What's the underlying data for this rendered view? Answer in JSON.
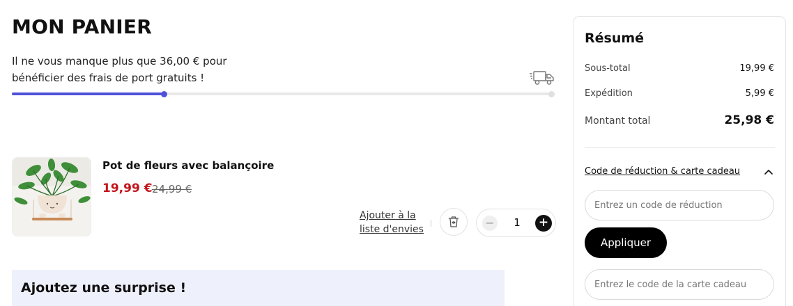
{
  "cart": {
    "title": "MON PANIER",
    "shipping_message": "Il ne vous manque plus que 36,00 € pour bénéficier des frais de port gratuits !",
    "free_shipping_progress": 0.28,
    "icons": {
      "truck": "delivery-truck-icon",
      "trash": "trash-icon",
      "minus": "minus-icon",
      "plus": "plus-icon"
    },
    "item": {
      "name": "Pot de fleurs avec balançoire",
      "price": "19,99 €",
      "original_price": "24,99 €",
      "wishlist_label": "Ajouter à la liste d'envies",
      "quantity": "1",
      "minus_label": "−",
      "plus_label": "+"
    },
    "surprise_title": "Ajoutez une surprise !"
  },
  "summary": {
    "title": "Résumé",
    "subtotal_label": "Sous-total",
    "subtotal_value": "19,99 €",
    "shipping_label": "Expédition",
    "shipping_value": "5,99 €",
    "total_label": "Montant total",
    "total_value": "25,98 €",
    "coupon_toggle": "Code de réduction & carte cadeau",
    "coupon_expanded": true,
    "discount_placeholder": "Entrez un code de réduction",
    "apply_label": "Appliquer",
    "giftcard_placeholder": "Entrez le code de la carte cadeau"
  },
  "colors": {
    "accent": "#4f52d8",
    "sale_price": "#c2141b",
    "surprise_background": "#eef0fc",
    "button": "#000000"
  }
}
